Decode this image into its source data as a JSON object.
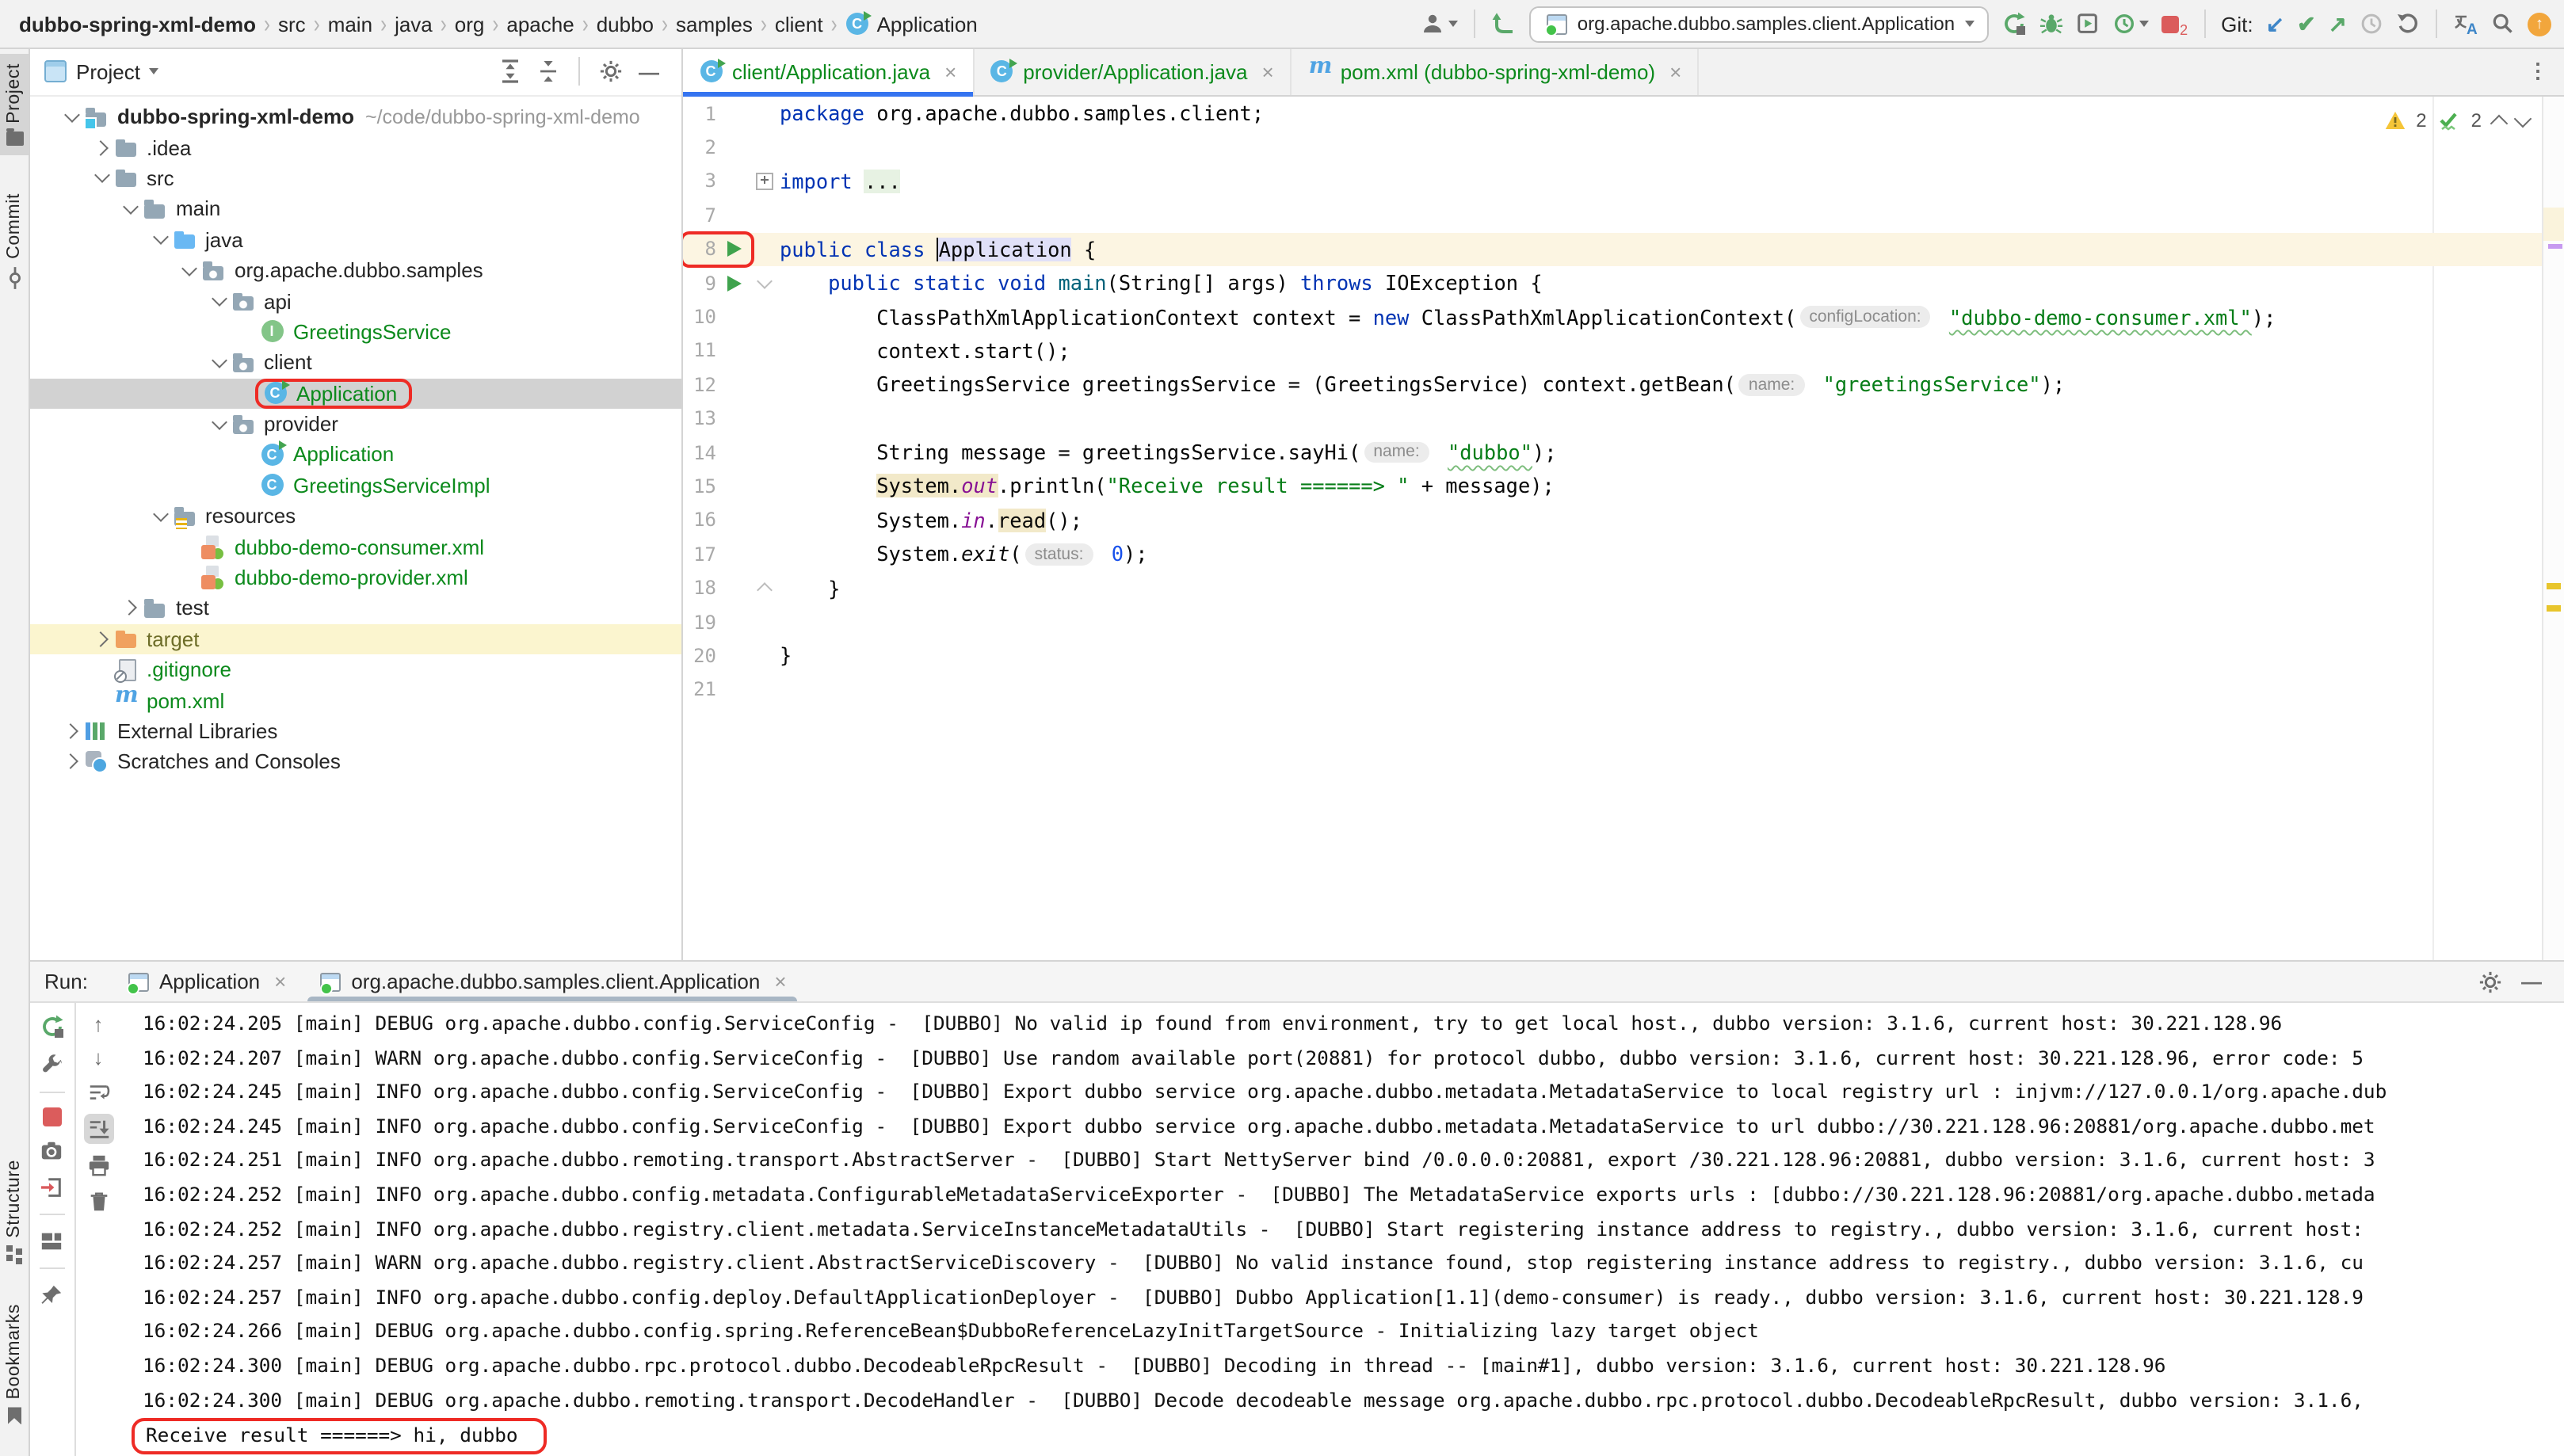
{
  "breadcrumbs": {
    "items": [
      "dubbo-spring-xml-demo",
      "src",
      "main",
      "java",
      "org",
      "apache",
      "dubbo",
      "samples",
      "client",
      "Application"
    ]
  },
  "toolbar": {
    "run_config": "org.apache.dubbo.samples.client.Application",
    "git_label": "Git:",
    "stop_count": "2",
    "icons": [
      "user-icon",
      "build-arrow-icon",
      "rerun-icon",
      "debug-icon",
      "coverage-icon",
      "profiler-icon",
      "stop-icon",
      "git-update-icon",
      "git-commit-icon",
      "git-push-icon",
      "history-icon",
      "rollback-icon",
      "translate-icon",
      "search-icon",
      "ide-update-icon"
    ]
  },
  "stripe": {
    "top": [
      "Project",
      "Commit"
    ],
    "bottom": [
      "Structure",
      "Bookmarks"
    ]
  },
  "project": {
    "title": "Project",
    "tree": [
      {
        "lvl": 0,
        "chev": "open",
        "icon": "project-root",
        "label": "dubbo-spring-xml-demo",
        "cls": "bold",
        "suffix": "~/code/dubbo-spring-xml-demo"
      },
      {
        "lvl": 1,
        "chev": "closed",
        "icon": "folder",
        "label": ".idea"
      },
      {
        "lvl": 1,
        "chev": "open",
        "icon": "folder",
        "label": "src"
      },
      {
        "lvl": 2,
        "chev": "open",
        "icon": "folder",
        "label": "main"
      },
      {
        "lvl": 3,
        "chev": "open",
        "icon": "folder-java",
        "label": "java"
      },
      {
        "lvl": 4,
        "chev": "open",
        "icon": "package",
        "label": "org.apache.dubbo.samples"
      },
      {
        "lvl": 5,
        "chev": "open",
        "icon": "package",
        "label": "api"
      },
      {
        "lvl": 6,
        "chev": null,
        "icon": "interface",
        "label": "GreetingsService",
        "cls": "green"
      },
      {
        "lvl": 5,
        "chev": "open",
        "icon": "package",
        "label": "client"
      },
      {
        "lvl": 6,
        "chev": null,
        "icon": "class-run",
        "label": "Application",
        "cls": "green",
        "sel": true,
        "box": true
      },
      {
        "lvl": 5,
        "chev": "open",
        "icon": "package",
        "label": "provider"
      },
      {
        "lvl": 6,
        "chev": null,
        "icon": "class-run",
        "label": "Application",
        "cls": "green"
      },
      {
        "lvl": 6,
        "chev": null,
        "icon": "class",
        "label": "GreetingsServiceImpl",
        "cls": "green"
      },
      {
        "lvl": 3,
        "chev": "open",
        "icon": "resources",
        "label": "resources"
      },
      {
        "lvl": 4,
        "chev": null,
        "icon": "spring-xml",
        "label": "dubbo-demo-consumer.xml",
        "cls": "green"
      },
      {
        "lvl": 4,
        "chev": null,
        "icon": "spring-xml",
        "label": "dubbo-demo-provider.xml",
        "cls": "green"
      },
      {
        "lvl": 2,
        "chev": "closed",
        "icon": "folder",
        "label": "test"
      },
      {
        "lvl": 1,
        "chev": "closed",
        "icon": "folder-excluded",
        "label": "target",
        "cls": "olive",
        "hl": true
      },
      {
        "lvl": 1,
        "chev": null,
        "icon": "gitignore",
        "label": ".gitignore",
        "cls": "green"
      },
      {
        "lvl": 1,
        "chev": null,
        "icon": "maven",
        "label": "pom.xml",
        "cls": "green"
      },
      {
        "lvl": 0,
        "chev": "closed",
        "icon": "libs",
        "label": "External Libraries"
      },
      {
        "lvl": 0,
        "chev": "closed",
        "icon": "scratches",
        "label": "Scratches and Consoles"
      }
    ]
  },
  "editor": {
    "tabs": [
      {
        "icon": "class-run",
        "label": "client/Application.java",
        "active": true
      },
      {
        "icon": "class-run",
        "label": "provider/Application.java",
        "active": false
      },
      {
        "icon": "maven",
        "label": "pom.xml (dubbo-spring-xml-demo)",
        "active": false
      }
    ],
    "inspections": {
      "warnings": "2",
      "ok": "2"
    },
    "lines": [
      {
        "n": "1",
        "tokens": [
          {
            "t": "package",
            "c": "k"
          },
          {
            "t": " org.apache.dubbo.samples.client;",
            "c": "p"
          }
        ]
      },
      {
        "n": "2",
        "tokens": []
      },
      {
        "n": "3",
        "fold": "plus",
        "tokens": [
          {
            "t": "import",
            "c": "k"
          },
          {
            "t": " ",
            "c": "p"
          },
          {
            "t": "...",
            "c": "fold"
          }
        ]
      },
      {
        "n": "7",
        "tokens": []
      },
      {
        "n": "8",
        "run": true,
        "cur": true,
        "box": true,
        "tokens": [
          {
            "t": "public",
            "c": "k"
          },
          {
            "t": " ",
            "c": "p"
          },
          {
            "t": "class",
            "c": "k"
          },
          {
            "t": " ",
            "c": "p"
          },
          {
            "t": "",
            "c": "caret"
          },
          {
            "t": "Application",
            "c": "sel"
          },
          {
            "t": " {",
            "c": "p"
          }
        ]
      },
      {
        "n": "9",
        "run": true,
        "fold": "open",
        "tokens": [
          {
            "t": "    ",
            "c": "p"
          },
          {
            "t": "public",
            "c": "k"
          },
          {
            "t": " ",
            "c": "p"
          },
          {
            "t": "static",
            "c": "k"
          },
          {
            "t": " ",
            "c": "p"
          },
          {
            "t": "void",
            "c": "k"
          },
          {
            "t": " ",
            "c": "p"
          },
          {
            "t": "main",
            "c": "m"
          },
          {
            "t": "(String[] args) ",
            "c": "p"
          },
          {
            "t": "throws",
            "c": "k"
          },
          {
            "t": " IOException {",
            "c": "p"
          }
        ]
      },
      {
        "n": "10",
        "tokens": [
          {
            "t": "        ClassPathXmlApplicationContext context = ",
            "c": "p"
          },
          {
            "t": "new",
            "c": "k"
          },
          {
            "t": " ClassPathXmlApplicationContext(",
            "c": "p"
          },
          {
            "t": "configLocation:",
            "c": "inlay"
          },
          {
            "t": " ",
            "c": "p"
          },
          {
            "t": "\"dubbo-demo-consumer.xml\"",
            "c": "s wavy"
          },
          {
            "t": ");",
            "c": "p"
          }
        ]
      },
      {
        "n": "11",
        "tokens": [
          {
            "t": "        context.start();",
            "c": "p"
          }
        ]
      },
      {
        "n": "12",
        "tokens": [
          {
            "t": "        GreetingsService greetingsService = (GreetingsService) context.getBean(",
            "c": "p"
          },
          {
            "t": "name:",
            "c": "inlay"
          },
          {
            "t": " ",
            "c": "p"
          },
          {
            "t": "\"greetingsService\"",
            "c": "s"
          },
          {
            "t": ");",
            "c": "p"
          }
        ]
      },
      {
        "n": "13",
        "tokens": []
      },
      {
        "n": "14",
        "tokens": [
          {
            "t": "        String message = greetingsService.sayHi(",
            "c": "p"
          },
          {
            "t": "name:",
            "c": "inlay"
          },
          {
            "t": " ",
            "c": "p"
          },
          {
            "t": "\"dubbo\"",
            "c": "s wavy"
          },
          {
            "t": ");",
            "c": "p"
          }
        ]
      },
      {
        "n": "15",
        "tokens": [
          {
            "t": "        ",
            "c": "p"
          },
          {
            "t": "System",
            "c": "hl"
          },
          {
            "t": ".",
            "c": "hl"
          },
          {
            "t": "out",
            "c": "f hl"
          },
          {
            "t": ".println(",
            "c": "p"
          },
          {
            "t": "\"Receive result ======> \"",
            "c": "s"
          },
          {
            "t": " + message);",
            "c": "p"
          }
        ]
      },
      {
        "n": "16",
        "tokens": [
          {
            "t": "        System.",
            "c": "p"
          },
          {
            "t": "in",
            "c": "f"
          },
          {
            "t": ".",
            "c": "p"
          },
          {
            "t": "read",
            "c": "hl"
          },
          {
            "t": "();",
            "c": "p"
          }
        ]
      },
      {
        "n": "17",
        "tokens": [
          {
            "t": "        System.",
            "c": "p"
          },
          {
            "t": "exit",
            "c": "i"
          },
          {
            "t": "(",
            "c": "p"
          },
          {
            "t": "status:",
            "c": "inlay"
          },
          {
            "t": " ",
            "c": "p"
          },
          {
            "t": "0",
            "c": "n"
          },
          {
            "t": ");",
            "c": "p"
          }
        ]
      },
      {
        "n": "18",
        "fold": "end",
        "tokens": [
          {
            "t": "    }",
            "c": "p"
          }
        ]
      },
      {
        "n": "19",
        "tokens": []
      },
      {
        "n": "20",
        "tokens": [
          {
            "t": "}",
            "c": "p"
          }
        ]
      },
      {
        "n": "21",
        "tokens": []
      }
    ]
  },
  "run": {
    "label": "Run:",
    "tabs": [
      {
        "icon": "app-frame",
        "label": "Application",
        "active": false
      },
      {
        "icon": "app-frame",
        "label": "org.apache.dubbo.samples.client.Application",
        "active": true
      }
    ],
    "console": [
      {
        "text": "16:02:24.205 [main] DEBUG org.apache.dubbo.config.ServiceConfig -  [DUBBO] No valid ip found from environment, try to get local host., dubbo version: 3.1.6, current host: 30.221.128.96"
      },
      {
        "text": "16:02:24.207 [main] WARN org.apache.dubbo.config.ServiceConfig -  [DUBBO] Use random available port(20881) for protocol dubbo, dubbo version: 3.1.6, current host: 30.221.128.96, error code: 5"
      },
      {
        "text": "16:02:24.245 [main] INFO org.apache.dubbo.config.ServiceConfig -  [DUBBO] Export dubbo service org.apache.dubbo.metadata.MetadataService to local registry url : injvm://127.0.0.1/org.apache.dub"
      },
      {
        "text": "16:02:24.245 [main] INFO org.apache.dubbo.config.ServiceConfig -  [DUBBO] Export dubbo service org.apache.dubbo.metadata.MetadataService to url dubbo://30.221.128.96:20881/org.apache.dubbo.met"
      },
      {
        "text": "16:02:24.251 [main] INFO org.apache.dubbo.remoting.transport.AbstractServer -  [DUBBO] Start NettyServer bind /0.0.0.0:20881, export /30.221.128.96:20881, dubbo version: 3.1.6, current host: 3"
      },
      {
        "text": "16:02:24.252 [main] INFO org.apache.dubbo.config.metadata.ConfigurableMetadataServiceExporter -  [DUBBO] The MetadataService exports urls : [dubbo://30.221.128.96:20881/org.apache.dubbo.metada"
      },
      {
        "text": "16:02:24.252 [main] INFO org.apache.dubbo.registry.client.metadata.ServiceInstanceMetadataUtils -  [DUBBO] Start registering instance address to registry., dubbo version: 3.1.6, current host:"
      },
      {
        "text": "16:02:24.257 [main] WARN org.apache.dubbo.registry.client.AbstractServiceDiscovery -  [DUBBO] No valid instance found, stop registering instance address to registry., dubbo version: 3.1.6, cu"
      },
      {
        "text": "16:02:24.257 [main] INFO org.apache.dubbo.config.deploy.DefaultApplicationDeployer -  [DUBBO] Dubbo Application[1.1](demo-consumer) is ready., dubbo version: 3.1.6, current host: 30.221.128.9"
      },
      {
        "text": "16:02:24.266 [main] DEBUG org.apache.dubbo.config.spring.ReferenceBean$DubboReferenceLazyInitTargetSource - Initializing lazy target object"
      },
      {
        "text": "16:02:24.300 [main] DEBUG org.apache.dubbo.rpc.protocol.dubbo.DecodeableRpcResult -  [DUBBO] Decoding in thread -- [main#1], dubbo version: 3.1.6, current host: 30.221.128.96"
      },
      {
        "text": "16:02:24.300 [main] DEBUG org.apache.dubbo.remoting.transport.DecodeHandler -  [DUBBO] Decode decodeable message org.apache.dubbo.rpc.protocol.dubbo.DecodeableRpcResult, dubbo version: 3.1.6,"
      },
      {
        "text": "Receive result ======> hi, dubbo",
        "boxed": true
      }
    ]
  },
  "colors": {
    "accent_blue": "#3574f0",
    "vcs_added_green": "#0c8a1c",
    "annotation_red": "#ee2b25",
    "keyword": "#0033b3",
    "string": "#067d17",
    "number": "#1750eb",
    "field": "#871094",
    "current_line": "#fcf5e2",
    "selection_gray": "#d2d2d2",
    "excluded_row": "#fbf5cf",
    "run_green": "#3fa34d"
  }
}
